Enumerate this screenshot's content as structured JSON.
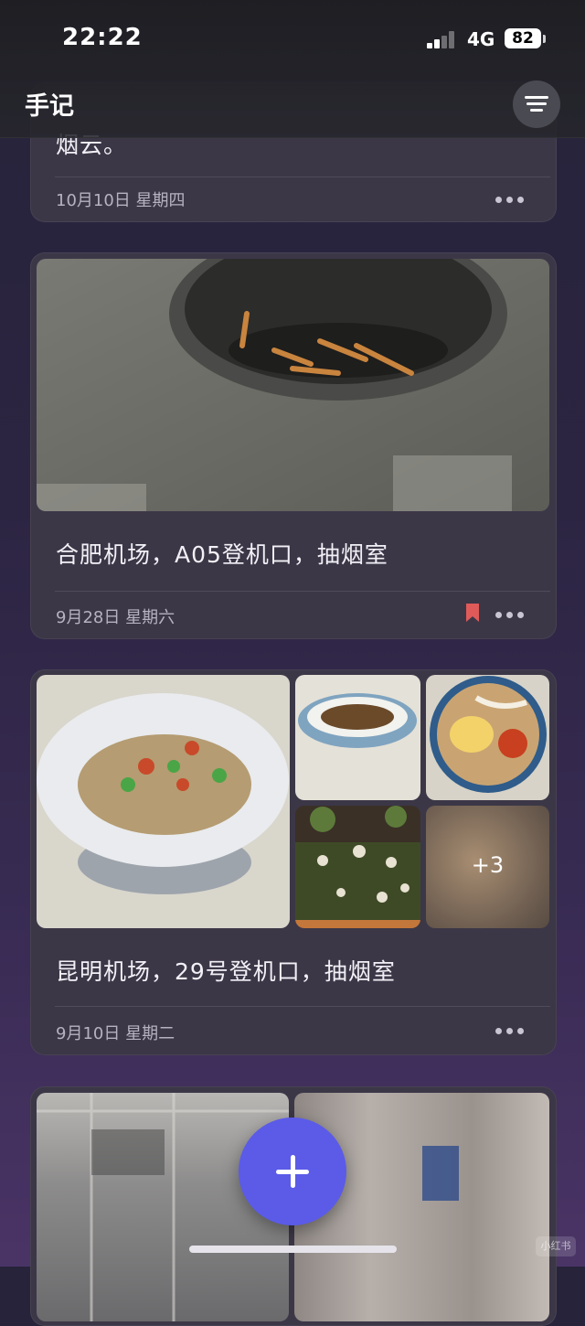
{
  "status": {
    "time": "22:22",
    "network": "4G",
    "battery": "82"
  },
  "header": {
    "title": "手记",
    "menu_icon": "filter-lines-icon"
  },
  "cards": [
    {
      "text": "烟云。",
      "date": "10月10日 星期四",
      "bookmarked": false
    },
    {
      "text": "合肥机场，A05登机口，抽烟室",
      "date": "9月28日 星期六",
      "bookmarked": true,
      "photos": [
        "ashtray-photo"
      ]
    },
    {
      "text": "昆明机场，29号登机口，抽烟室",
      "date": "9月10日 星期二",
      "bookmarked": false,
      "photos": [
        "dish-photo",
        "mushroom-plate-photo",
        "noodle-bowl-photo",
        "mushroom-display-photo",
        "blurred-photo"
      ],
      "more_count": "+3"
    },
    {
      "photos": [
        "airport-hall-photo",
        "airport-corridor-photo"
      ]
    }
  ],
  "fab": {
    "icon": "plus-icon"
  },
  "watermark": "小红书",
  "colors": {
    "accent": "#5b5be8",
    "bookmark": "#e05a5a",
    "card": "#3c3747"
  }
}
